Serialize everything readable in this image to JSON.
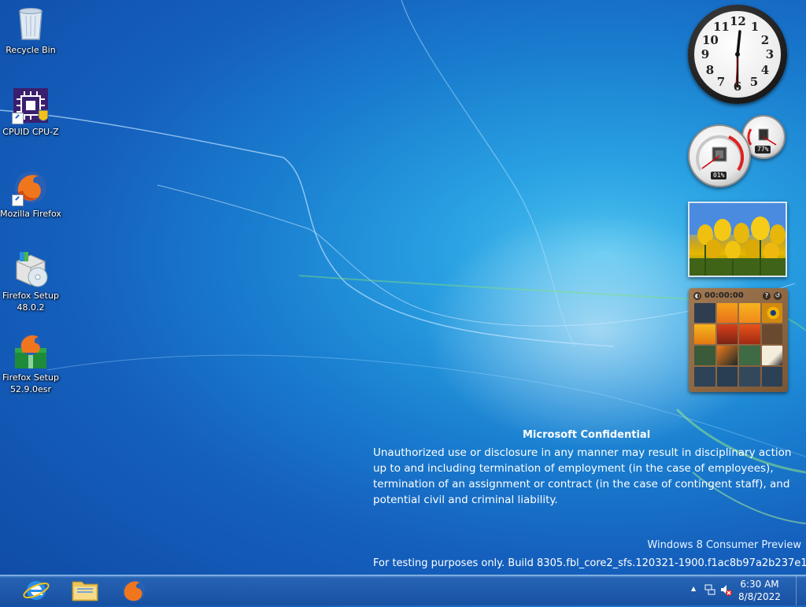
{
  "desktop_icons": [
    {
      "label": "Recycle Bin",
      "icon": "recycle-bin-icon"
    },
    {
      "label": "CPUID CPU-Z",
      "icon": "cpuz-icon"
    },
    {
      "label": "Mozilla Firefox",
      "icon": "firefox-icon"
    },
    {
      "label": "Firefox Setup 48.0.2",
      "icon": "installer-icon"
    },
    {
      "label": "Firefox Setup 52.9.0esr",
      "icon": "firefox-installer-icon"
    }
  ],
  "gadgets": {
    "clock": {
      "numbers": [
        "12",
        "1",
        "2",
        "3",
        "4",
        "5",
        "6",
        "7",
        "8",
        "9",
        "10",
        "11"
      ]
    },
    "cpu_meter": {
      "cpu_value": "01%",
      "memory_value": "77%"
    },
    "puzzle": {
      "timer": "00:00:00",
      "help": "?",
      "reset": "↺"
    }
  },
  "notice": {
    "title": "Microsoft Confidential",
    "body": "Unauthorized use or disclosure in any manner may result in disciplinary action up to and including termination of employment (in the case of employees), termination of an assignment or contract (in the case of contingent staff), and potential civil and criminal liability."
  },
  "watermark": {
    "edition": "Windows 8 Consumer Preview",
    "build": "For testing purposes only. Build 8305.fbl_core2_sfs.120321-1900.f1ac8b97a2b237e1"
  },
  "taskbar": {
    "pinned": [
      {
        "name": "Internet Explorer",
        "icon": "internet-explorer-icon"
      },
      {
        "name": "File Explorer",
        "icon": "folder-icon"
      },
      {
        "name": "Mozilla Firefox",
        "icon": "firefox-icon"
      }
    ],
    "tray": {
      "show_hidden": "▲",
      "time": "6:30 AM",
      "date": "8/8/2022"
    }
  },
  "colors": {
    "accent": "#1a7fd0",
    "taskbar": "#1d5aa8"
  }
}
